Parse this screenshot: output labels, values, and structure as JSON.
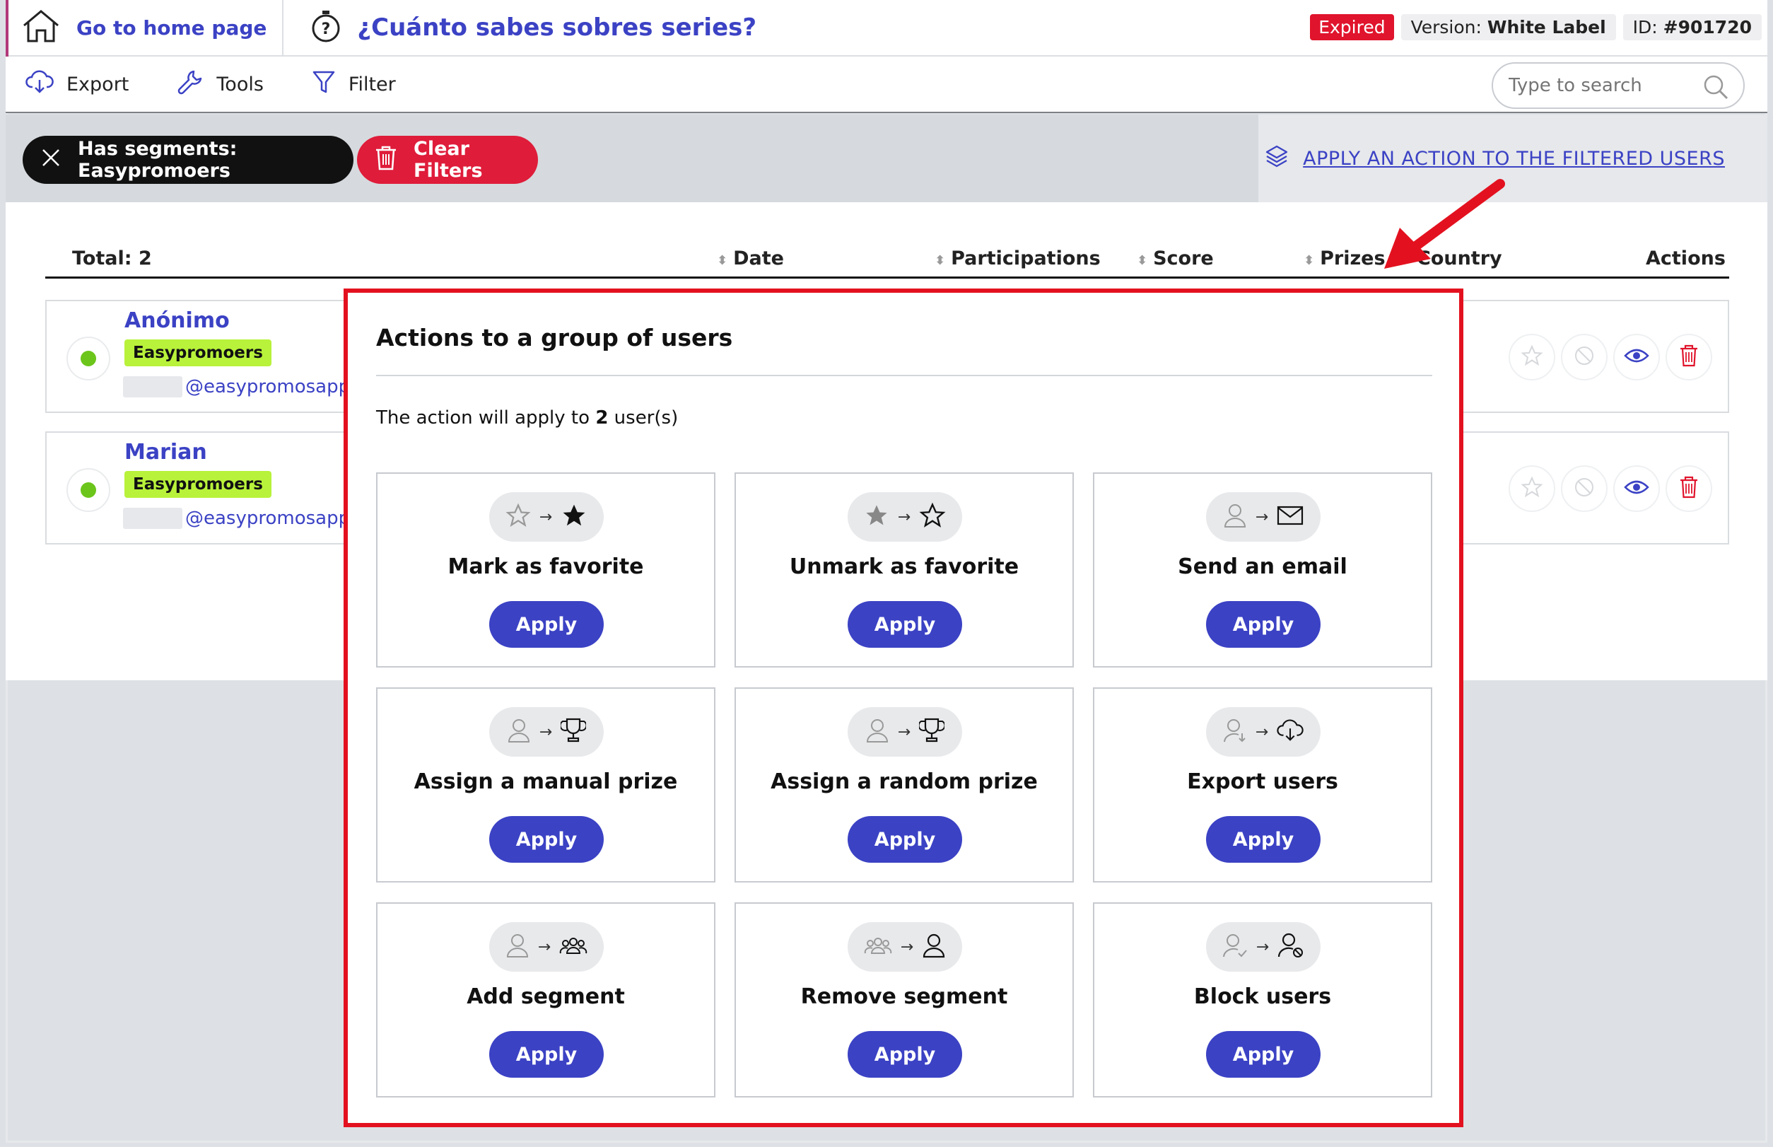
{
  "header": {
    "home_label": "Go to home page",
    "quiz_title": "¿Cuánto sabes sobres series?",
    "status": "Expired",
    "version_label": "Version:",
    "version_value": "White Label",
    "id_label": "ID:",
    "id_value": "#901720"
  },
  "toolbar": {
    "export_label": "Export",
    "tools_label": "Tools",
    "filter_label": "Filter",
    "search_placeholder": "Type to search"
  },
  "filters": {
    "active_filter": "Has segments: Easypromoers",
    "clear_label": "Clear Filters",
    "apply_action_link": "APPLY AN ACTION TO THE FILTERED USERS"
  },
  "table": {
    "total": "Total: 2",
    "columns": [
      "Date",
      "Participations",
      "Score",
      "Prizes",
      "Country",
      "Actions"
    ],
    "rows": [
      {
        "name": "Anónimo",
        "segment": "Easypromoers",
        "email_domain": "@easypromosapp."
      },
      {
        "name": "Marian",
        "segment": "Easypromoers",
        "email_domain": "@easypromosapp."
      }
    ]
  },
  "modal": {
    "title": "Actions to a group of users",
    "info_prefix": "The action will apply to",
    "info_count": "2",
    "info_suffix": "user(s)",
    "apply_label": "Apply",
    "actions": [
      {
        "label": "Mark as favorite"
      },
      {
        "label": "Unmark as favorite"
      },
      {
        "label": "Send an email"
      },
      {
        "label": "Assign a manual prize"
      },
      {
        "label": "Assign a random prize"
      },
      {
        "label": "Export users"
      },
      {
        "label": "Add segment"
      },
      {
        "label": "Remove segment"
      },
      {
        "label": "Block users"
      }
    ]
  },
  "colors": {
    "brand_blue": "#3b42c4",
    "expired_red": "#e0142c",
    "segment_green": "#b8f23a",
    "modal_border": "#e3111f"
  }
}
